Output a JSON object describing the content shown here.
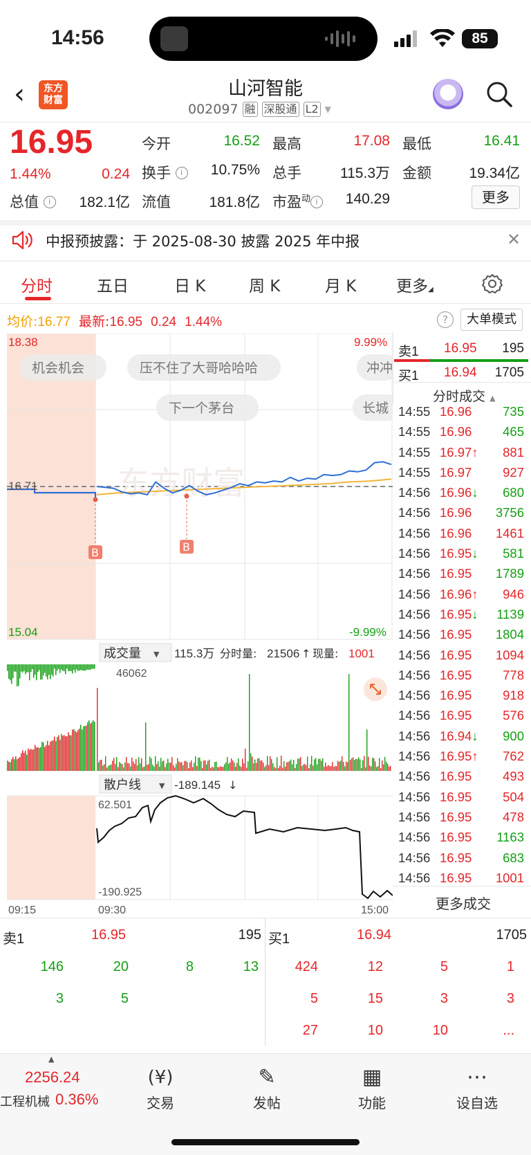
{
  "status": {
    "time": "14:56",
    "battery": "85"
  },
  "header": {
    "logo_line1": "东方",
    "logo_line2": "财富",
    "title": "山河智能",
    "code": "002097",
    "tags": [
      "融",
      "深股通",
      "L2"
    ]
  },
  "quote": {
    "price": "16.95",
    "change_pct": "1.44%",
    "change": "0.24",
    "fields": [
      {
        "label": "今开",
        "value": "16.52",
        "color": "green"
      },
      {
        "label": "最高",
        "value": "17.08",
        "color": "red"
      },
      {
        "label": "最低",
        "value": "16.41",
        "color": "green"
      },
      {
        "label": "换手",
        "value": "10.75%",
        "color": "dark"
      },
      {
        "label": "总手",
        "value": "115.3万",
        "color": "dark"
      },
      {
        "label": "金额",
        "value": "19.34亿",
        "color": "dark"
      },
      {
        "label": "总值",
        "value": "182.1亿",
        "color": "dark"
      },
      {
        "label": "流值",
        "value": "181.8亿",
        "color": "dark"
      },
      {
        "label": "市盈",
        "value": "140.29",
        "color": "dark"
      }
    ],
    "pe_sup": "动",
    "more_label": "更多"
  },
  "notice": {
    "text": "中报预披露：于 2025-08-30 披露 2025 年中报"
  },
  "tabs": [
    "分时",
    "五日",
    "日 K",
    "周 K",
    "月 K",
    "更多"
  ],
  "avg_row": {
    "avg_label": "均价:",
    "avg_value": "16.77",
    "last_label": "最新:",
    "last_value": "16.95",
    "change": "0.24",
    "change_pct": "1.44%",
    "big_mode": "大单模式"
  },
  "chart_data": {
    "type": "line",
    "price_axis": {
      "top": "18.38",
      "bottom": "15.04",
      "pct_top": "9.99%",
      "pct_bottom": "-9.99%",
      "ref": "16.71"
    },
    "time_labels": [
      "09:15",
      "09:30",
      "15:00"
    ],
    "danmaku": [
      "机会机会",
      "压不住了大哥哈哈哈",
      "冲冲",
      "下一个茅台",
      "长城"
    ],
    "markers": [
      "B",
      "B"
    ],
    "price_series": [
      16.71,
      16.7,
      16.69,
      16.65,
      16.63,
      16.64,
      16.62,
      16.76,
      16.69,
      16.64,
      16.67,
      16.72,
      16.66,
      16.62,
      16.64,
      16.67,
      16.7,
      16.74,
      16.72,
      16.76,
      16.75,
      16.77,
      16.76,
      16.81,
      16.77,
      16.8,
      16.79,
      16.84,
      16.83,
      16.84,
      16.88,
      16.87,
      16.89,
      16.97,
      16.98,
      16.95
    ],
    "avg_series": [
      16.62,
      16.64,
      16.65,
      16.66,
      16.67,
      16.68,
      16.69,
      16.7,
      16.71,
      16.72,
      16.73,
      16.74,
      16.76,
      16.77,
      16.79
    ],
    "volume": {
      "label": "成交量",
      "total": "115.3万",
      "tick_label": "分时量:",
      "tick_value": "21506",
      "now_label": "现量:",
      "now_value": "1001",
      "max": "46062"
    },
    "retail": {
      "label": "散户线",
      "value": "-189.145",
      "top": "62.501",
      "bottom": "-190.925"
    }
  },
  "orderbook": {
    "sell1": {
      "label": "卖1",
      "price": "16.95",
      "vol": "195"
    },
    "buy1": {
      "label": "买1",
      "price": "16.94",
      "vol": "1705"
    },
    "trades_title": "分时成交",
    "trades": [
      {
        "t": "14:55",
        "p": "16.96",
        "arrow": "",
        "v": "735",
        "vc": "green"
      },
      {
        "t": "14:55",
        "p": "16.96",
        "arrow": "",
        "v": "465",
        "vc": "green"
      },
      {
        "t": "14:55",
        "p": "16.97",
        "arrow": "↑",
        "v": "881",
        "vc": "red"
      },
      {
        "t": "14:55",
        "p": "16.97",
        "arrow": "",
        "v": "927",
        "vc": "red"
      },
      {
        "t": "14:56",
        "p": "16.96",
        "arrow": "↓",
        "v": "680",
        "vc": "green"
      },
      {
        "t": "14:56",
        "p": "16.96",
        "arrow": "",
        "v": "3756",
        "vc": "green"
      },
      {
        "t": "14:56",
        "p": "16.96",
        "arrow": "",
        "v": "1461",
        "vc": "red"
      },
      {
        "t": "14:56",
        "p": "16.95",
        "arrow": "↓",
        "v": "581",
        "vc": "green"
      },
      {
        "t": "14:56",
        "p": "16.95",
        "arrow": "",
        "v": "1789",
        "vc": "green"
      },
      {
        "t": "14:56",
        "p": "16.96",
        "arrow": "↑",
        "v": "946",
        "vc": "red"
      },
      {
        "t": "14:56",
        "p": "16.95",
        "arrow": "↓",
        "v": "1139",
        "vc": "green"
      },
      {
        "t": "14:56",
        "p": "16.95",
        "arrow": "",
        "v": "1804",
        "vc": "green"
      },
      {
        "t": "14:56",
        "p": "16.95",
        "arrow": "",
        "v": "1094",
        "vc": "red"
      },
      {
        "t": "14:56",
        "p": "16.95",
        "arrow": "",
        "v": "778",
        "vc": "red"
      },
      {
        "t": "14:56",
        "p": "16.95",
        "arrow": "",
        "v": "918",
        "vc": "red"
      },
      {
        "t": "14:56",
        "p": "16.95",
        "arrow": "",
        "v": "576",
        "vc": "red"
      },
      {
        "t": "14:56",
        "p": "16.94",
        "arrow": "↓",
        "v": "900",
        "vc": "green"
      },
      {
        "t": "14:56",
        "p": "16.95",
        "arrow": "↑",
        "v": "762",
        "vc": "red"
      },
      {
        "t": "14:56",
        "p": "16.95",
        "arrow": "",
        "v": "493",
        "vc": "red"
      },
      {
        "t": "14:56",
        "p": "16.95",
        "arrow": "",
        "v": "504",
        "vc": "red"
      },
      {
        "t": "14:56",
        "p": "16.95",
        "arrow": "",
        "v": "478",
        "vc": "red"
      },
      {
        "t": "14:56",
        "p": "16.95",
        "arrow": "",
        "v": "1163",
        "vc": "green"
      },
      {
        "t": "14:56",
        "p": "16.95",
        "arrow": "",
        "v": "683",
        "vc": "green"
      },
      {
        "t": "14:56",
        "p": "16.95",
        "arrow": "",
        "v": "1001",
        "vc": "red"
      }
    ],
    "more_trades": "更多成交"
  },
  "depth": {
    "sell_label": "卖1",
    "sell_price": "16.95",
    "sell_vol": "195",
    "buy_label": "买1",
    "buy_price": "16.94",
    "buy_vol": "1705",
    "sell_queue": [
      "146",
      "20",
      "8",
      "13",
      "3",
      "5"
    ],
    "buy_queue": [
      "424",
      "12",
      "5",
      "1",
      "5",
      "15",
      "3",
      "3",
      "27",
      "10",
      "10",
      "..."
    ]
  },
  "bottom_nav": {
    "index_value": "2256.24",
    "index_name": "工程机械",
    "index_pct": "0.36%",
    "items": [
      "交易",
      "发帖",
      "功能",
      "设自选"
    ]
  }
}
